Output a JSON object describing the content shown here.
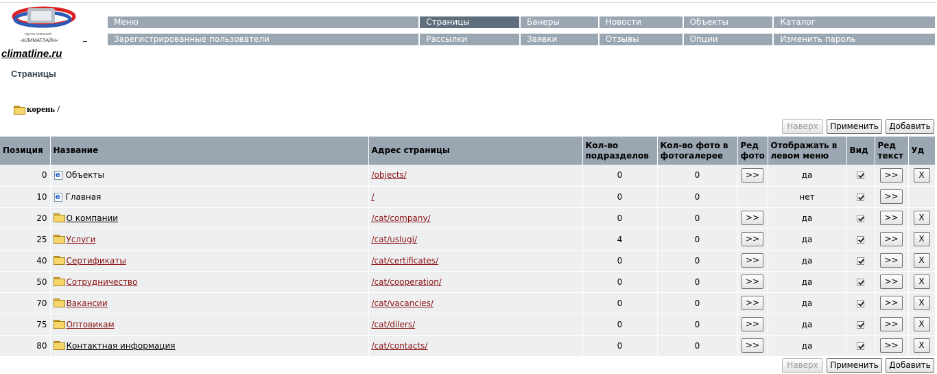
{
  "brand": {
    "logo_small": "группа компаний",
    "logo_name": "«КЛИМАТЛАЙН»",
    "site": "climatline.ru"
  },
  "menu": {
    "row1": [
      "Меню",
      "Страницы",
      "Банеры",
      "Новости",
      "Объекты",
      "Каталог"
    ],
    "row2": [
      "Зарегистрированные пользователи",
      "Рассылки",
      "Заявки",
      "Отзывы",
      "Опции",
      "Изменить пароль"
    ],
    "active": "Страницы",
    "colors": {
      "item": "#9aa6b2",
      "active": "#5f6e7c"
    }
  },
  "page_title": "Страницы",
  "breadcrumb": {
    "icon": "folder-icon",
    "label": "корень /"
  },
  "actions": {
    "up": "Наверх",
    "apply": "Применить",
    "add": "Добавить"
  },
  "table": {
    "headers": {
      "pos": "Позиция",
      "name": "Название",
      "url": "Адрес страницы",
      "subs": "Кол-во подразделов",
      "photos": "Кол-во фото в фотогалерее",
      "edit_photo": "Ред фото",
      "show_left": "Отображать в левом меню",
      "view": "Вид",
      "edit_text": "Ред текст",
      "del": "Уд"
    },
    "rows": [
      {
        "pos": "0",
        "icon": "page-icon",
        "name": "Объекты",
        "url": "/objects/",
        "subs": "0",
        "photos": "0",
        "edit_photo": ">>",
        "show_left": "да",
        "edit_text": ">>",
        "del": "X"
      },
      {
        "pos": "10",
        "icon": "page-icon",
        "name": "Главная",
        "url": "/",
        "subs": "0",
        "photos": "0",
        "edit_photo": "",
        "show_left": "нет",
        "edit_text": ">>",
        "del": ""
      },
      {
        "pos": "20",
        "icon": "folder-icon",
        "name": "О компании",
        "url": "/cat/company/",
        "subs": "0",
        "photos": "0",
        "edit_photo": ">>",
        "show_left": "да",
        "edit_text": ">>",
        "del": "X"
      },
      {
        "pos": "25",
        "icon": "folder-icon",
        "name": "Услуги",
        "url": "/cat/uslugi/",
        "subs": "4",
        "photos": "0",
        "edit_photo": ">>",
        "show_left": "да",
        "edit_text": ">>",
        "del": "X"
      },
      {
        "pos": "40",
        "icon": "folder-icon",
        "name": "Сертификаты",
        "url": "/cat/certificates/",
        "subs": "0",
        "photos": "0",
        "edit_photo": ">>",
        "show_left": "да",
        "edit_text": ">>",
        "del": "X"
      },
      {
        "pos": "50",
        "icon": "folder-icon",
        "name": "Сотрудничество",
        "url": "/cat/cooperation/",
        "subs": "0",
        "photos": "0",
        "edit_photo": ">>",
        "show_left": "да",
        "edit_text": ">>",
        "del": "X"
      },
      {
        "pos": "70",
        "icon": "folder-icon",
        "name": "Вакансии",
        "url": "/cat/vacancies/",
        "subs": "0",
        "photos": "0",
        "edit_photo": ">>",
        "show_left": "да",
        "edit_text": ">>",
        "del": "X"
      },
      {
        "pos": "75",
        "icon": "folder-icon",
        "name": "Оптовикам",
        "url": "/cat/dilers/",
        "subs": "0",
        "photos": "0",
        "edit_photo": ">>",
        "show_left": "да",
        "edit_text": ">>",
        "del": "X"
      },
      {
        "pos": "80",
        "icon": "folder-icon",
        "name": "Контактная информация",
        "url": "/cat/contacts/",
        "subs": "0",
        "photos": "0",
        "edit_photo": ">>",
        "show_left": "да",
        "edit_text": ">>",
        "del": "X"
      }
    ]
  }
}
